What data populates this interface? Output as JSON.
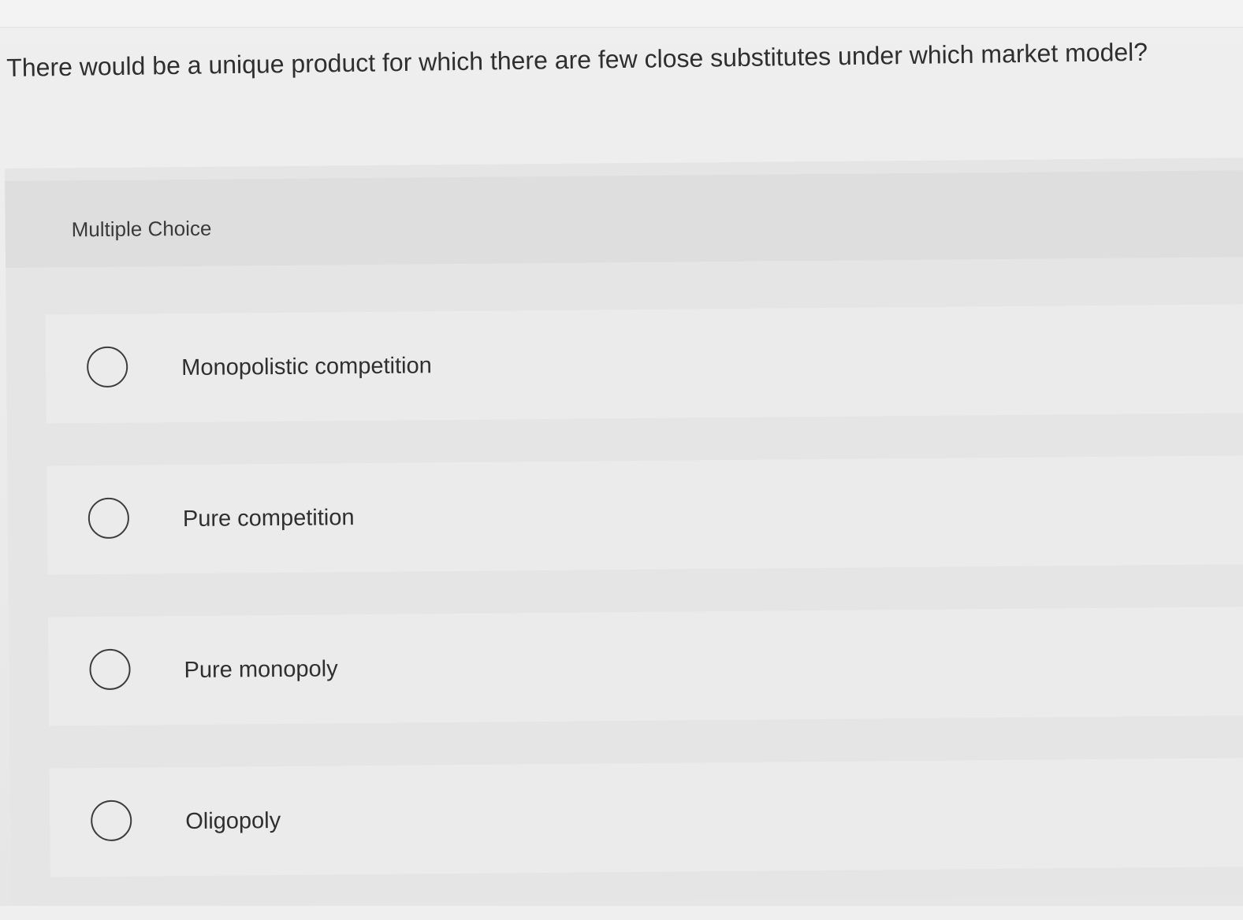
{
  "question": {
    "text": "There would be a unique product for which there are few close substitutes under which market model?"
  },
  "quiz": {
    "type_label": "Multiple Choice",
    "options": [
      {
        "label": "Monopolistic competition",
        "selected": false
      },
      {
        "label": "Pure competition",
        "selected": false
      },
      {
        "label": "Pure monopoly",
        "selected": false
      },
      {
        "label": "Oligopoly",
        "selected": false
      }
    ]
  },
  "icons": {
    "radio": "radio-unchecked-icon"
  },
  "colors": {
    "background": "#ececec",
    "panel": "#e5e5e5",
    "option_background": "#ebebeb",
    "text": "#2f2f2f",
    "radio_border": "#3d3d3d"
  }
}
